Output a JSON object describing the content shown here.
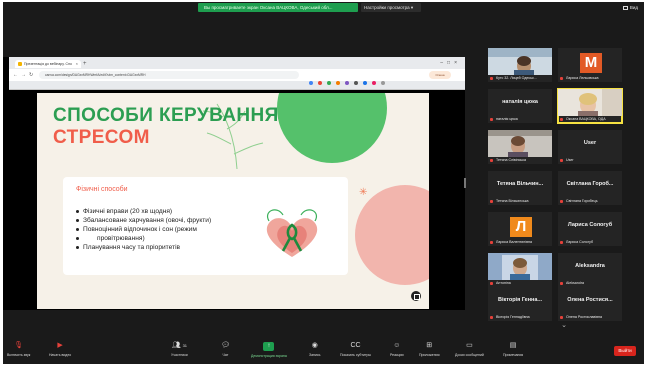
{
  "top_bar": {
    "share_status": "Вы просматриваете экран Оксана ВАЦКОВА, Одеський обл...",
    "share_options": "Настройки просмотра",
    "view_label": "Вид"
  },
  "browser": {
    "tab_title": "Презентація до вебінару. Спо",
    "url": "canva.com/design/DAGxxMRHWmfA/edit?utm_content=DAGxxMRH",
    "profile": "Олена"
  },
  "slide": {
    "title_line1": "СПОСОБИ КЕРУВАННЯ",
    "title_line2": "СТРЕСОМ",
    "card_heading": "Фізичні способи",
    "bullets": [
      "Фізичні вправи (20 хв щодня)",
      "Збалансоване харчування (овочі, фрукти)",
      "Повноцінний   відпочинок   і   сон   (режим",
      "провітрювання)",
      "Планування часу та пріоритетів"
    ]
  },
  "gallery": {
    "tiles": [
      {
        "name": "Кутс 32. Лицей Одеськ...",
        "big": ""
      },
      {
        "name": "Лариса Лельовська",
        "big": "",
        "initial": "M"
      },
      {
        "name": "наталія цюка",
        "big": "наталія цюка"
      },
      {
        "name": "Оксана ВАЦКОВА, ОДА",
        "big": ""
      },
      {
        "name": "Тетяна Слівінська",
        "big": ""
      },
      {
        "name": "User",
        "big": "User"
      },
      {
        "name": "Тетяна Вільчинська",
        "big": "Тетяна Вільчин..."
      },
      {
        "name": "Світлана Горобець",
        "big": "Світлана Гороб..."
      },
      {
        "name": "Лариса Валентинівна",
        "big": "",
        "initial": "Л"
      },
      {
        "name": "Лариса Сологуб",
        "big": "Лариса Сологуб"
      },
      {
        "name": "Антоніна",
        "big": ""
      },
      {
        "name": "Aleksandra",
        "big": "Aleksandra"
      },
      {
        "name": "Вікторія Геннадіївна",
        "big": "Вікторія Генна..."
      },
      {
        "name": "Олена Ростиславівна",
        "big": "Олена Ростися..."
      }
    ]
  },
  "toolbar": {
    "mic": "Включить звук",
    "video": "Начать видео",
    "participants": "Участники",
    "participants_count": "31",
    "chat": "Чат",
    "share": "Демонстрация экрана",
    "record": "Запись",
    "captions": "Показать субтитры",
    "reactions": "Реакции",
    "apps": "Приложения",
    "whiteboards": "Доски сообщений",
    "notes": "Примечания",
    "leave": "Выйти"
  }
}
